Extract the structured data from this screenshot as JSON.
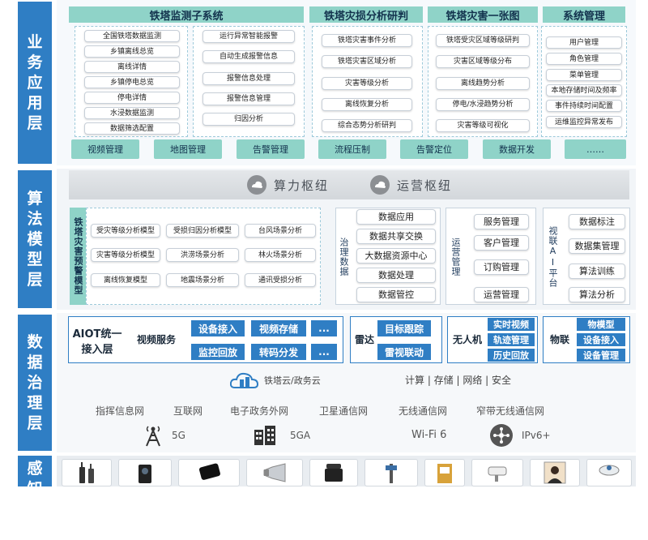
{
  "layers": {
    "business": "业务应用层",
    "algorithm": "算法模型层",
    "data_gov": "数据治理层",
    "perception": "感知网络"
  },
  "business": {
    "monitor": {
      "title": "铁塔监测子系统",
      "col1": [
        "全国铁塔数据监测",
        "乡镇离线总览",
        "离线详情",
        "乡镇停电总览",
        "停电详情",
        "水浸数据监测",
        "数据筛选配置"
      ],
      "col2": [
        "运行异常智能报警",
        "自动生成报警信息",
        "报警信息处理",
        "报警信息管理",
        "归因分析"
      ]
    },
    "disaster_analysis": {
      "title": "铁塔灾损分析研判",
      "items": [
        "铁塔灾害事件分析",
        "铁塔灾害区域分析",
        "灾害等级分析",
        "离线恢复分析",
        "综合态势分析研判"
      ]
    },
    "disaster_map": {
      "title": "铁塔灾害一张图",
      "items": [
        "铁塔受灾区域等级研判",
        "灾害区域等级分布",
        "离线趋势分析",
        "停电/水浸趋势分析",
        "灾害等级可视化"
      ]
    },
    "system": {
      "title": "系统管理",
      "items": [
        "用户管理",
        "角色管理",
        "菜单管理",
        "本地存储时间及频率",
        "事件持续时间配置",
        "运维监控异常发布"
      ]
    },
    "tools": [
      "视频管理",
      "地图管理",
      "告警管理",
      "流程压制",
      "告警定位",
      "数据开发",
      "……"
    ]
  },
  "algorithm": {
    "hub": [
      "算力枢纽",
      "运营枢纽"
    ],
    "warn_model": {
      "title": "铁塔灾害预警模型",
      "items": [
        "受灾等级分析模型",
        "受损归因分析模型",
        "台风场景分析",
        "灾害等级分析模型",
        "洪涝场景分析",
        "林火场景分析",
        "离线恢复模型",
        "地震场景分析",
        "通讯受损分析"
      ]
    },
    "gov_data": {
      "title": "治理数据",
      "items": [
        "数据应用",
        "数据共享交换",
        "大数据资源中心",
        "数据处理",
        "数据管控"
      ]
    },
    "ops_mgmt": {
      "title": "运营管理",
      "items": [
        "服务管理",
        "客户管理",
        "订购管理",
        "运营管理"
      ]
    },
    "ai_platform": {
      "title": "视联AI平台",
      "items": [
        "数据标注",
        "数据集管理",
        "算法训练",
        "算法分析"
      ]
    }
  },
  "data_gov": {
    "aiot": "AIOT统一接入层",
    "video_service": "视频服务",
    "video_btns": [
      "设备接入",
      "视频存储",
      "...",
      "监控回放",
      "转码分发",
      "..."
    ],
    "radar": "雷达",
    "radar_btns": [
      "目标跟踪",
      "雷视联动"
    ],
    "drone": "无人机",
    "drone_btns": [
      "实时视频",
      "轨迹管理",
      "历史回放"
    ],
    "iot": "物联",
    "iot_btns": [
      "物模型",
      "设备接入",
      "设备管理"
    ],
    "cloud": "铁塔云/政务云",
    "capabilities": "计算 | 存储 | 网络 | 安全",
    "networks": [
      "指挥信息网",
      "互联网",
      "电子政务外网",
      "卫星通信网",
      "无线通信网",
      "窄带无线通信网"
    ],
    "techs": [
      "5G",
      "5GA",
      "Wi-Fi 6",
      "IPv6+"
    ]
  },
  "devices": [
    "radio-device",
    "camera-device",
    "phone-device",
    "speaker-device",
    "deskphone-device",
    "tower-sensor-device",
    "gauge-device",
    "panel-device",
    "cctv-device",
    "person-device",
    "dish-device"
  ]
}
